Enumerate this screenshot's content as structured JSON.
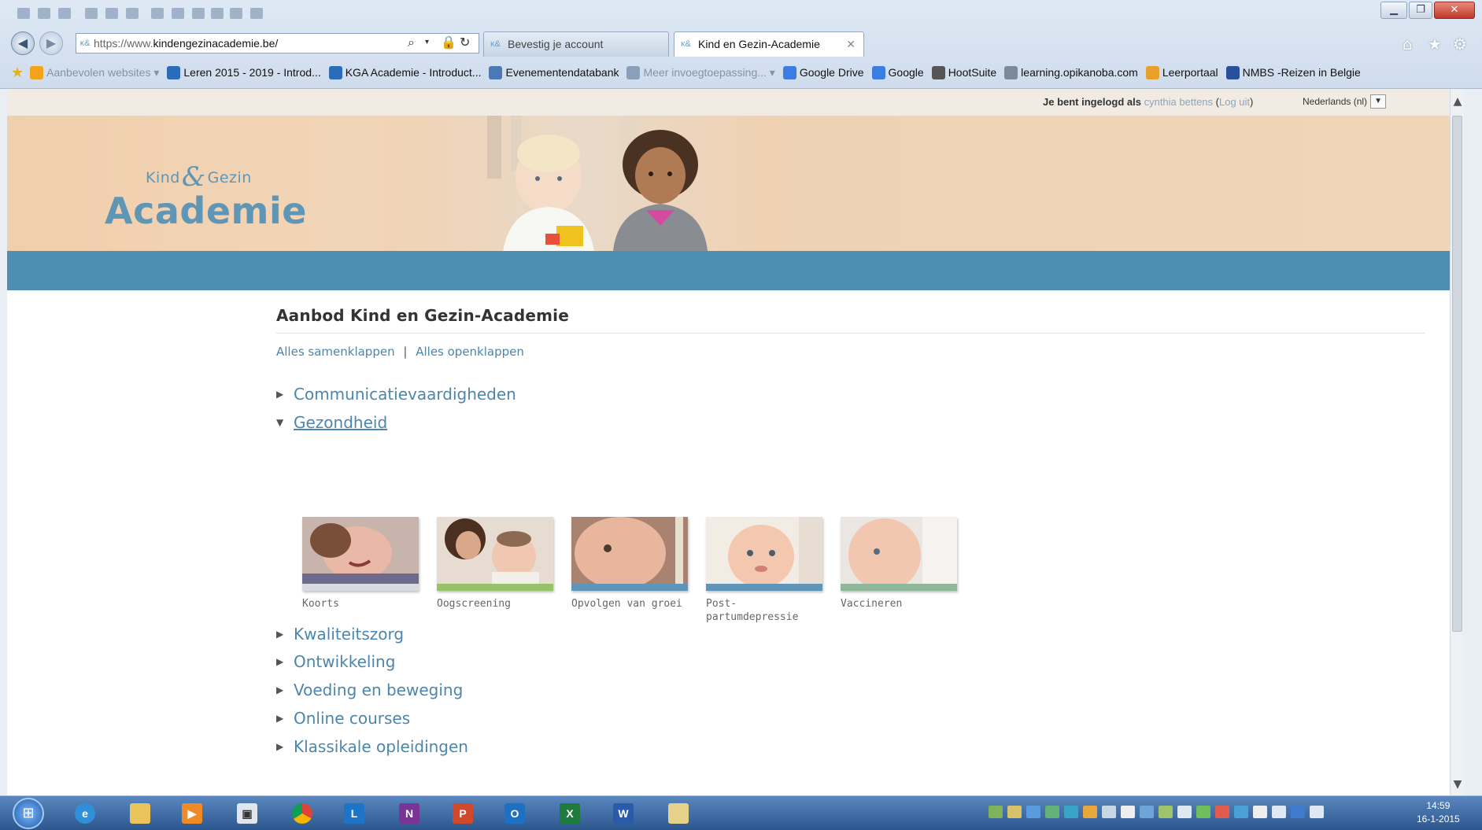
{
  "browser": {
    "address": {
      "protocol": "https://www.",
      "host": "kindengezinacademie.be/"
    },
    "tabs": [
      {
        "title": "Bevestig je account",
        "active": false
      },
      {
        "title": "Kind en Gezin-Academie",
        "active": true
      }
    ],
    "bookmarks": [
      {
        "label": "Aanbevolen websites ▾",
        "color": "#f2a21b",
        "faded": true
      },
      {
        "label": "Leren 2015 - 2019 - Introd...",
        "color": "#2b6cb8",
        "faded": false
      },
      {
        "label": "KGA Academie - Introduct...",
        "color": "#2b6cb8",
        "faded": false
      },
      {
        "label": "Evenementendatabank",
        "color": "#4a79b5",
        "faded": false
      },
      {
        "label": "Meer invoegtoepassing... ▾",
        "color": "#8aa0b8",
        "faded": true
      },
      {
        "label": "Google Drive",
        "color": "#3b7de0",
        "faded": false
      },
      {
        "label": "Google",
        "color": "#3b7de0",
        "faded": false
      },
      {
        "label": "HootSuite",
        "color": "#555555",
        "faded": false
      },
      {
        "label": "learning.opikanoba.com",
        "color": "#7a8a9a",
        "faded": false
      },
      {
        "label": "Leerportaal",
        "color": "#e8a02a",
        "faded": false
      },
      {
        "label": "NMBS -Reizen in Belgie",
        "color": "#2a4f9c",
        "faded": false
      }
    ]
  },
  "site": {
    "login": {
      "prefix": "Je bent ingelogd als",
      "user": "cynthia bettens",
      "open_paren": " (",
      "logout": "Log uit",
      "close_paren": ")"
    },
    "language": "Nederlands (nl)",
    "logo": {
      "small_left": "Kind",
      "amp": "&",
      "small_right": "Gezin",
      "big": "Academie"
    }
  },
  "main": {
    "title": "Aanbod Kind en Gezin-Academie",
    "collapse_all": "Alles samenklappen",
    "separator": "|",
    "expand_all": "Alles openklappen",
    "categories": [
      {
        "label": "Communicatievaardigheden",
        "open": false
      },
      {
        "label": "Gezondheid",
        "open": true
      },
      {
        "label": "Kwaliteitszorg",
        "open": false
      },
      {
        "label": "Ontwikkeling",
        "open": false
      },
      {
        "label": "Voeding en beweging",
        "open": false
      },
      {
        "label": "Online courses",
        "open": false
      },
      {
        "label": "Klassikale opleidingen",
        "open": false
      }
    ],
    "courses": [
      {
        "title": "Koorts",
        "band_color": "#d8dce0",
        "image": "koorts"
      },
      {
        "title": "Oogscreening",
        "band_color": "#98c26a",
        "image": "oogscreening"
      },
      {
        "title": "Opvolgen van groei",
        "band_color": "#5e95b8",
        "image": "groei"
      },
      {
        "title": "Post-\npartumdepressie",
        "band_color": "#5e95b8",
        "image": "postpartum"
      },
      {
        "title": "Vaccineren",
        "band_color": "#8fb79a",
        "image": "vaccineren"
      }
    ]
  },
  "taskbar": {
    "apps": [
      "ie",
      "explorer",
      "media",
      "window",
      "chrome",
      "lync",
      "onenote",
      "powerpoint",
      "outlook",
      "excel",
      "word",
      "folder"
    ],
    "clock_time": "14:59",
    "clock_date": "16-1-2015"
  }
}
